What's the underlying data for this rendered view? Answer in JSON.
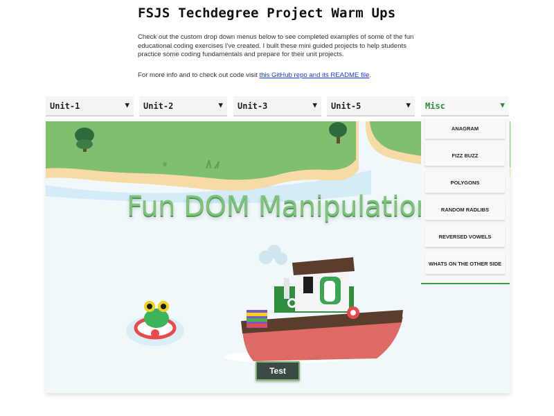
{
  "header": {
    "title": "FSJS Techdegree Project Warm Ups",
    "intro": "Check out the custom drop down menus below to see completed examples of some of the fun educational coding exercises I've created. I built these mini guided projects to help students practice some coding fundamentals and prepare for their unit projects.",
    "info_prefix": "For more info and to check out code visit ",
    "info_link": "this GitHub repo and its README file",
    "info_suffix": "."
  },
  "dropdowns": [
    {
      "label": "Unit-1",
      "arrow": "▼"
    },
    {
      "label": "Unit-2",
      "arrow": "▼"
    },
    {
      "label": "Unit-3",
      "arrow": "▼"
    },
    {
      "label": "Unit-5",
      "arrow": "▼"
    },
    {
      "label": "Misc",
      "arrow": "▼",
      "open": true
    }
  ],
  "misc_menu": {
    "items": [
      "ANAGRAM",
      "FIZZ BUZZ",
      "POLYGONS",
      "RANDOM RADLIBS",
      "REVERSED VOWELS",
      "WHATS ON THE OTHER SIDE"
    ]
  },
  "scene": {
    "heading": "Fun DOM Manipulation",
    "button_label": "Test"
  },
  "colors": {
    "accent_green": "#2e8b3a",
    "heading_green": "#7dc47a",
    "water": "#f1f8fc",
    "button_bg": "#3b4a45",
    "link": "#1a3cf5"
  }
}
